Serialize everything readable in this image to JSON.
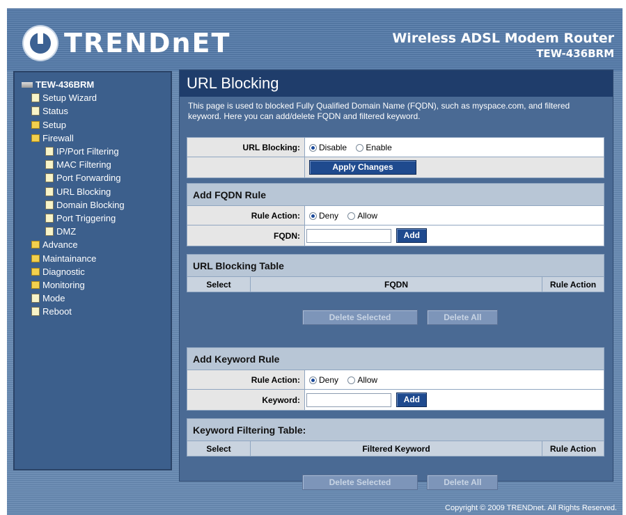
{
  "brand": {
    "logo_text": "TRENDnET",
    "product_name": "Wireless ADSL Modem Router",
    "model": "TEW-436BRM"
  },
  "sidebar": {
    "root": "TEW-436BRM",
    "items": [
      {
        "label": "Setup Wizard",
        "type": "doc",
        "level": 1
      },
      {
        "label": "Status",
        "type": "doc",
        "level": 1
      },
      {
        "label": "Setup",
        "type": "folder",
        "level": 1
      },
      {
        "label": "Firewall",
        "type": "folder-open",
        "level": 1
      },
      {
        "label": "IP/Port Filtering",
        "type": "doc",
        "level": 2
      },
      {
        "label": "MAC Filtering",
        "type": "doc",
        "level": 2
      },
      {
        "label": "Port Forwarding",
        "type": "doc",
        "level": 2
      },
      {
        "label": "URL Blocking",
        "type": "doc",
        "level": 2
      },
      {
        "label": "Domain Blocking",
        "type": "doc",
        "level": 2
      },
      {
        "label": "Port Triggering",
        "type": "doc",
        "level": 2
      },
      {
        "label": "DMZ",
        "type": "doc",
        "level": 2
      },
      {
        "label": "Advance",
        "type": "folder",
        "level": 1
      },
      {
        "label": "Maintainance",
        "type": "folder",
        "level": 1
      },
      {
        "label": "Diagnostic",
        "type": "folder",
        "level": 1
      },
      {
        "label": "Monitoring",
        "type": "folder",
        "level": 1
      },
      {
        "label": "Mode",
        "type": "doc",
        "level": 1
      },
      {
        "label": "Reboot",
        "type": "doc",
        "level": 1
      }
    ]
  },
  "page": {
    "title": "URL Blocking",
    "description": "This page is used to blocked Fully Qualified Domain Name (FQDN), such as myspace.com, and filtered keyword. Here you can add/delete FQDN and filtered keyword."
  },
  "url_blocking": {
    "label": "URL Blocking:",
    "options": [
      "Disable",
      "Enable"
    ],
    "selected": "Disable",
    "apply_label": "Apply Changes"
  },
  "fqdn_rule": {
    "header": "Add FQDN Rule",
    "rule_action_label": "Rule Action:",
    "options": [
      "Deny",
      "Allow"
    ],
    "selected": "Deny",
    "fqdn_label": "FQDN:",
    "fqdn_value": "",
    "add_label": "Add"
  },
  "url_table": {
    "header": "URL Blocking Table",
    "columns": [
      "Select",
      "FQDN",
      "Rule Action"
    ],
    "delete_selected": "Delete Selected",
    "delete_all": "Delete All"
  },
  "keyword_rule": {
    "header": "Add Keyword Rule",
    "rule_action_label": "Rule Action:",
    "options": [
      "Deny",
      "Allow"
    ],
    "selected": "Deny",
    "keyword_label": "Keyword:",
    "keyword_value": "",
    "add_label": "Add"
  },
  "keyword_table": {
    "header": "Keyword Filtering Table:",
    "columns": [
      "Select",
      "Filtered Keyword",
      "Rule Action"
    ],
    "delete_selected": "Delete Selected",
    "delete_all": "Delete All"
  },
  "footer": {
    "copyright": "Copyright © 2009 TRENDnet. All Rights Reserved."
  }
}
